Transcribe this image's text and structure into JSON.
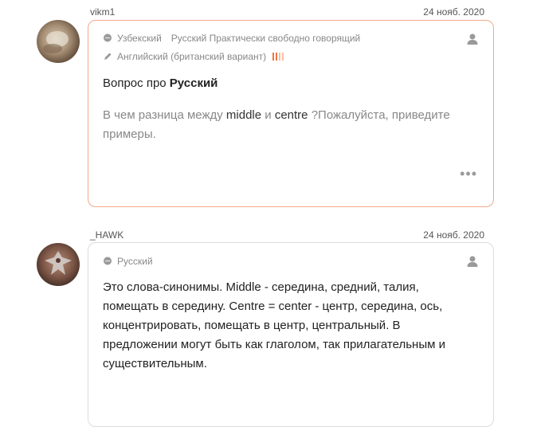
{
  "posts": [
    {
      "author": "vikm1",
      "date": "24 нояб. 2020",
      "native_lang": "Узбекский",
      "study_langs": "Русский Практически свободно говорящий",
      "learning_lang": "Английский (британский вариант)",
      "question_prefix": "Вопрос про ",
      "question_lang": "Русский",
      "text_part1": "В чем разница между ",
      "term1": "middle",
      "text_part2": " и ",
      "term2": "centre",
      "text_part3": " ?Пожалуйста, приведите примеры.",
      "more_label": "•••"
    },
    {
      "author": "_HAWK",
      "date": "24 нояб. 2020",
      "native_lang": "Русский",
      "answer": "Это слова-синонимы. Middle - середина, средний, талия, помещать в середину. Centre = center - центр, середина, ось, концентрировать, помещать в центр, центральный. В предложении могут быть как глаголом, так прилагательным и существительным."
    }
  ],
  "colors": {
    "highlight_border": "#f3a88b",
    "level_bar_active": "#f0743e",
    "level_bar_inactive": "#f5c0a6"
  },
  "icons": {
    "speech": "speech-bubble-icon",
    "pencil": "pencil-icon",
    "user": "user-icon",
    "more": "more-dots-icon"
  }
}
